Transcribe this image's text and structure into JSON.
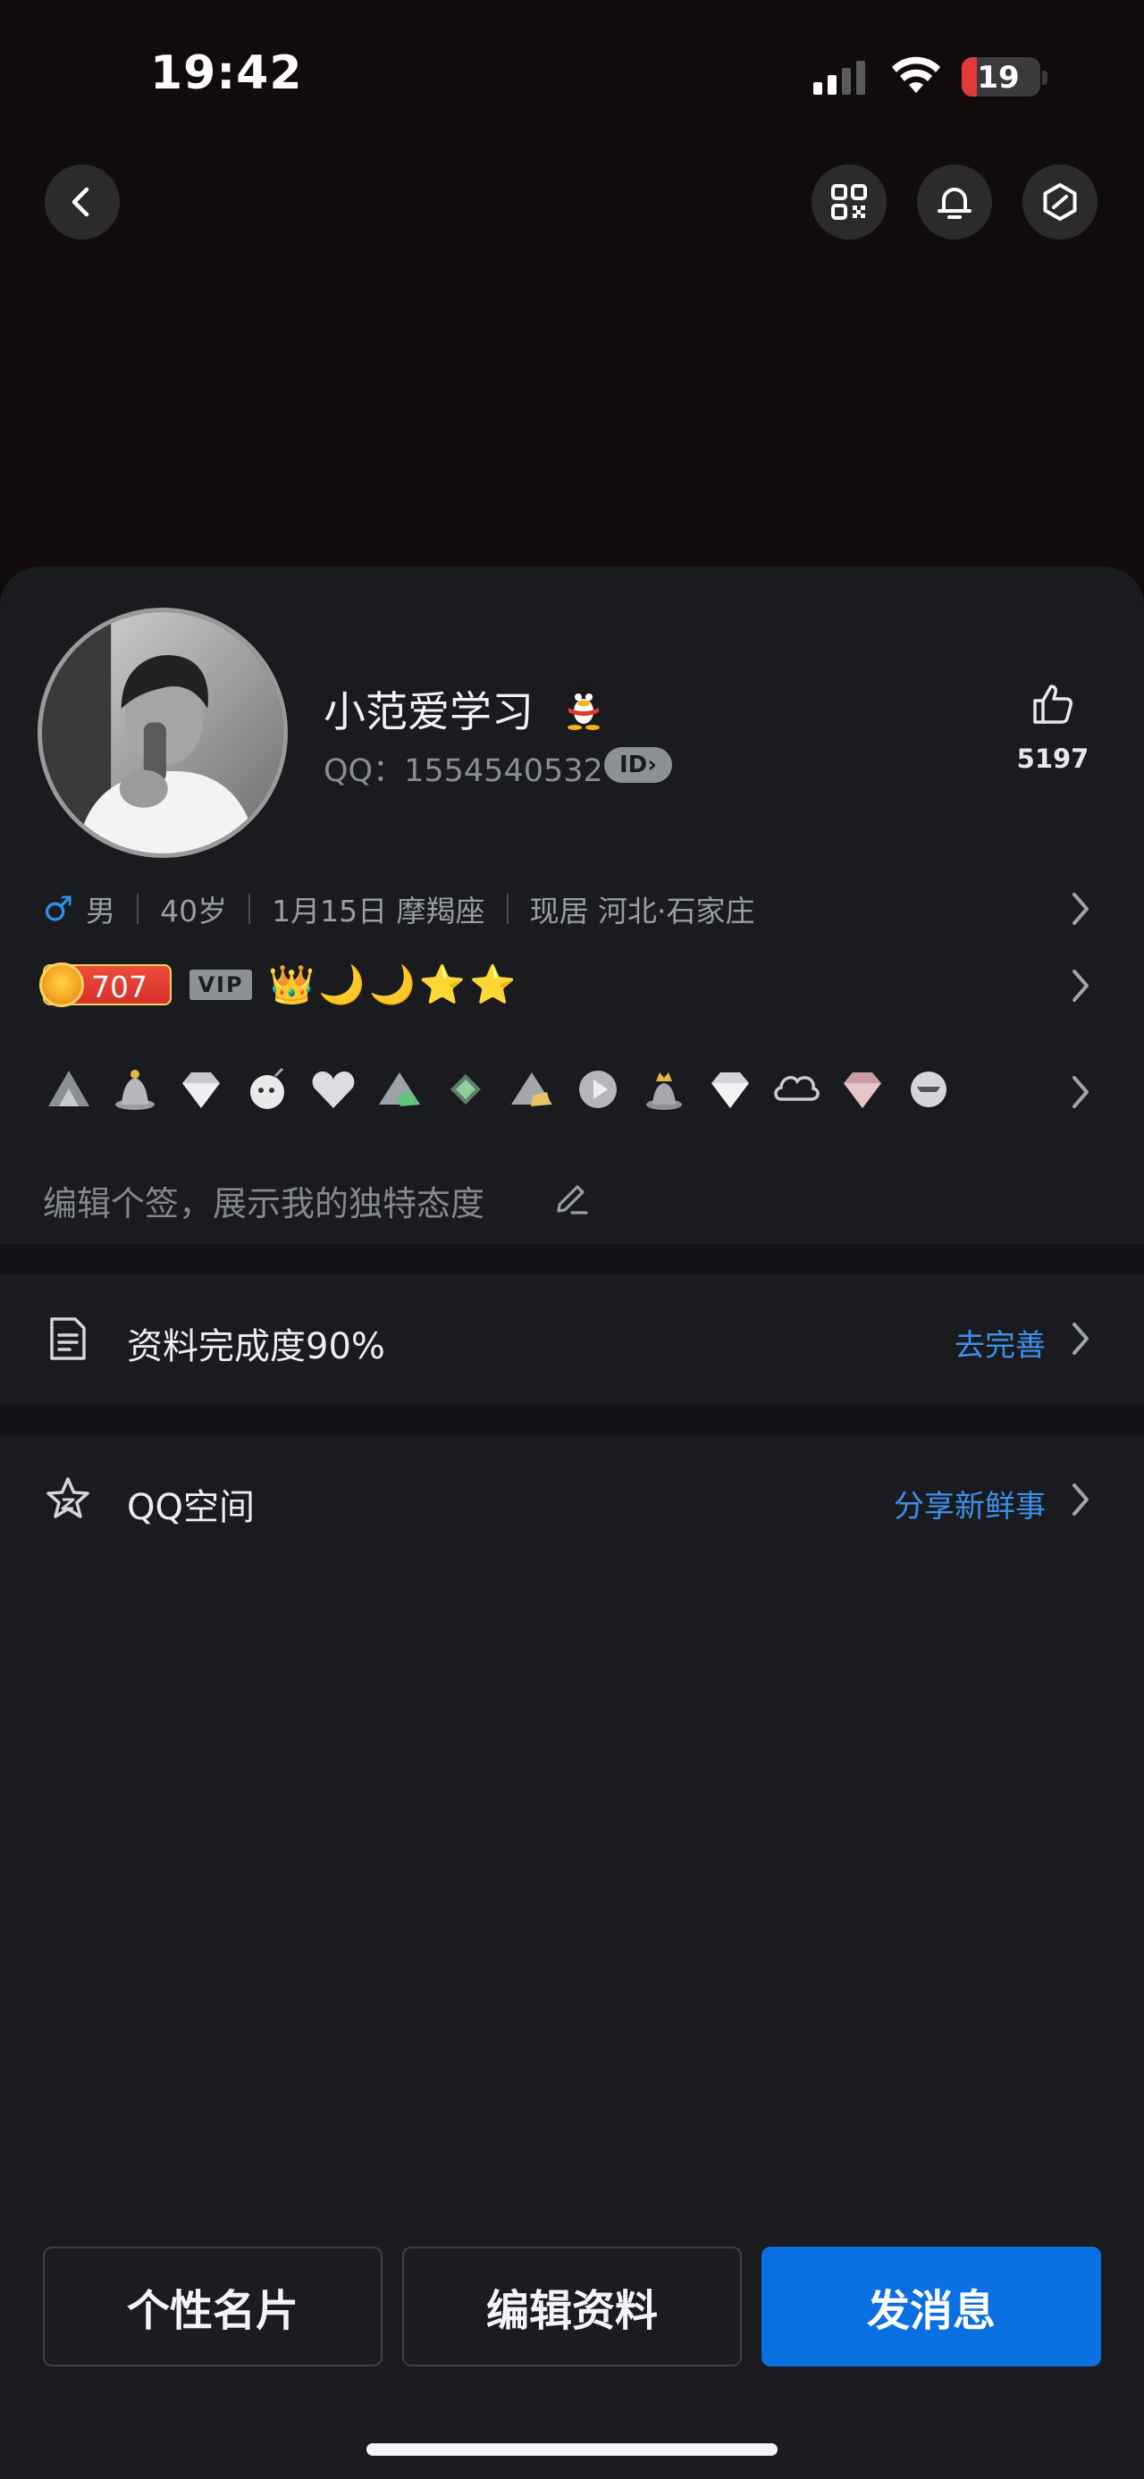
{
  "status_bar": {
    "time": "19:42",
    "battery": "19",
    "battery_level": 0.19
  },
  "nav": {
    "back_icon": "chevron-left-icon",
    "qr_icon": "qr-code-icon",
    "bell_icon": "bell-icon",
    "settings_icon": "hexagon-settings-icon"
  },
  "profile": {
    "nickname": "小范爱学习",
    "qq": "QQ：1554540532",
    "id_badge": "ID",
    "likes": "5197"
  },
  "info": {
    "gender": "男",
    "age": "40岁",
    "birthday": "1月15日 摩羯座",
    "location": "现居 河北·石家庄"
  },
  "level": {
    "value": "707",
    "vip": "VIP",
    "icons": [
      "👑",
      "🌙",
      "🌙",
      "⭐",
      "⭐"
    ]
  },
  "medals": [
    "mountain-medal",
    "hat-medal",
    "diamond-medal",
    "bomb-medal",
    "heart-medal",
    "mountain-green-medal",
    "gem-medal",
    "mountain-gold-medal",
    "play-medal",
    "crown-medal",
    "diamond-medal",
    "cloud-medal",
    "pink-diamond-medal",
    "cf-medal"
  ],
  "signature": {
    "placeholder": "编辑个签，展示我的独特态度"
  },
  "rows": {
    "completion": {
      "label": "资料完成度90%",
      "action": "去完善"
    },
    "qzone": {
      "label": "QQ空间",
      "action": "分享新鲜事"
    }
  },
  "buttons": {
    "card": "个性名片",
    "edit": "编辑资料",
    "message": "发消息"
  },
  "colors": {
    "accent": "#0a6fe0",
    "link": "#3f8fe8",
    "background": "#191b1f",
    "male": "#2f8fea"
  }
}
